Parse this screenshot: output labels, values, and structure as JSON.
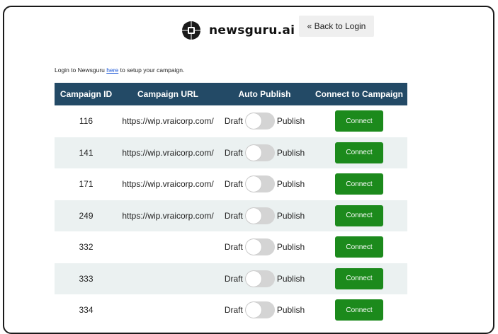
{
  "header": {
    "brand": "newsguru.ai",
    "back_label": "« Back to Login"
  },
  "intro": {
    "before": "Login to Newsguru ",
    "link": "here",
    "after": " to setup your campaign."
  },
  "table": {
    "columns": [
      "Campaign ID",
      "Campaign URL",
      "Auto Publish",
      "Connect to Campaign"
    ],
    "toggle_left": "Draft",
    "toggle_right": "Publish",
    "connect_label": "Connect",
    "rows": [
      {
        "id": "116",
        "url": "https://wip.vraicorp.com/"
      },
      {
        "id": "141",
        "url": "https://wip.vraicorp.com/"
      },
      {
        "id": "171",
        "url": "https://wip.vraicorp.com/"
      },
      {
        "id": "249",
        "url": "https://wip.vraicorp.com/"
      },
      {
        "id": "332",
        "url": ""
      },
      {
        "id": "333",
        "url": ""
      },
      {
        "id": "334",
        "url": ""
      }
    ]
  }
}
